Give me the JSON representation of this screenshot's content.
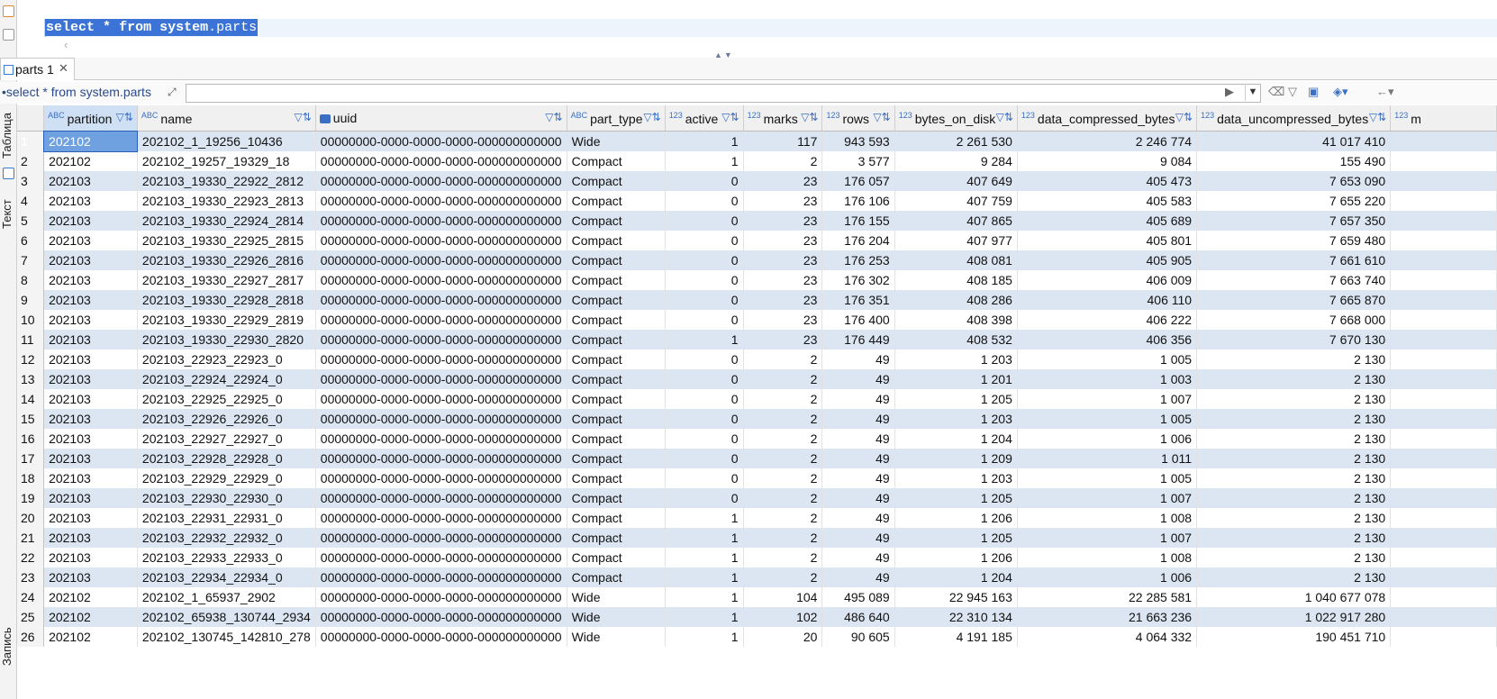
{
  "editor": {
    "sql_parts": [
      "select",
      "*",
      "from",
      "system",
      ".parts"
    ]
  },
  "result_tab": {
    "label": "parts 1"
  },
  "filter_bar": {
    "query_label": "select * from system.parts"
  },
  "side_tabs": [
    "Таблица",
    "Текст",
    "Запись"
  ],
  "grid": {
    "columns": [
      {
        "key": "partition",
        "type": "ABC"
      },
      {
        "key": "name",
        "type": "ABC"
      },
      {
        "key": "uuid",
        "type": "uuid"
      },
      {
        "key": "part_type",
        "type": "ABC"
      },
      {
        "key": "active",
        "type": "123"
      },
      {
        "key": "marks",
        "type": "123"
      },
      {
        "key": "rows",
        "type": "123"
      },
      {
        "key": "bytes_on_disk",
        "type": "123"
      },
      {
        "key": "data_compressed_bytes",
        "type": "123"
      },
      {
        "key": "data_uncompressed_bytes",
        "type": "123"
      },
      {
        "key": "m",
        "type": "123"
      }
    ],
    "rows": [
      [
        "1",
        "202102",
        "202102_1_19256_10436",
        "00000000-0000-0000-0000-000000000000",
        "Wide",
        "1",
        "117",
        "943 593",
        "2 261 530",
        "2 246 774",
        "41 017 410"
      ],
      [
        "2",
        "202102",
        "202102_19257_19329_18",
        "00000000-0000-0000-0000-000000000000",
        "Compact",
        "1",
        "2",
        "3 577",
        "9 284",
        "9 084",
        "155 490"
      ],
      [
        "3",
        "202103",
        "202103_19330_22922_2812",
        "00000000-0000-0000-0000-000000000000",
        "Compact",
        "0",
        "23",
        "176 057",
        "407 649",
        "405 473",
        "7 653 090"
      ],
      [
        "4",
        "202103",
        "202103_19330_22923_2813",
        "00000000-0000-0000-0000-000000000000",
        "Compact",
        "0",
        "23",
        "176 106",
        "407 759",
        "405 583",
        "7 655 220"
      ],
      [
        "5",
        "202103",
        "202103_19330_22924_2814",
        "00000000-0000-0000-0000-000000000000",
        "Compact",
        "0",
        "23",
        "176 155",
        "407 865",
        "405 689",
        "7 657 350"
      ],
      [
        "6",
        "202103",
        "202103_19330_22925_2815",
        "00000000-0000-0000-0000-000000000000",
        "Compact",
        "0",
        "23",
        "176 204",
        "407 977",
        "405 801",
        "7 659 480"
      ],
      [
        "7",
        "202103",
        "202103_19330_22926_2816",
        "00000000-0000-0000-0000-000000000000",
        "Compact",
        "0",
        "23",
        "176 253",
        "408 081",
        "405 905",
        "7 661 610"
      ],
      [
        "8",
        "202103",
        "202103_19330_22927_2817",
        "00000000-0000-0000-0000-000000000000",
        "Compact",
        "0",
        "23",
        "176 302",
        "408 185",
        "406 009",
        "7 663 740"
      ],
      [
        "9",
        "202103",
        "202103_19330_22928_2818",
        "00000000-0000-0000-0000-000000000000",
        "Compact",
        "0",
        "23",
        "176 351",
        "408 286",
        "406 110",
        "7 665 870"
      ],
      [
        "10",
        "202103",
        "202103_19330_22929_2819",
        "00000000-0000-0000-0000-000000000000",
        "Compact",
        "0",
        "23",
        "176 400",
        "408 398",
        "406 222",
        "7 668 000"
      ],
      [
        "11",
        "202103",
        "202103_19330_22930_2820",
        "00000000-0000-0000-0000-000000000000",
        "Compact",
        "1",
        "23",
        "176 449",
        "408 532",
        "406 356",
        "7 670 130"
      ],
      [
        "12",
        "202103",
        "202103_22923_22923_0",
        "00000000-0000-0000-0000-000000000000",
        "Compact",
        "0",
        "2",
        "49",
        "1 203",
        "1 005",
        "2 130"
      ],
      [
        "13",
        "202103",
        "202103_22924_22924_0",
        "00000000-0000-0000-0000-000000000000",
        "Compact",
        "0",
        "2",
        "49",
        "1 201",
        "1 003",
        "2 130"
      ],
      [
        "14",
        "202103",
        "202103_22925_22925_0",
        "00000000-0000-0000-0000-000000000000",
        "Compact",
        "0",
        "2",
        "49",
        "1 205",
        "1 007",
        "2 130"
      ],
      [
        "15",
        "202103",
        "202103_22926_22926_0",
        "00000000-0000-0000-0000-000000000000",
        "Compact",
        "0",
        "2",
        "49",
        "1 203",
        "1 005",
        "2 130"
      ],
      [
        "16",
        "202103",
        "202103_22927_22927_0",
        "00000000-0000-0000-0000-000000000000",
        "Compact",
        "0",
        "2",
        "49",
        "1 204",
        "1 006",
        "2 130"
      ],
      [
        "17",
        "202103",
        "202103_22928_22928_0",
        "00000000-0000-0000-0000-000000000000",
        "Compact",
        "0",
        "2",
        "49",
        "1 209",
        "1 011",
        "2 130"
      ],
      [
        "18",
        "202103",
        "202103_22929_22929_0",
        "00000000-0000-0000-0000-000000000000",
        "Compact",
        "0",
        "2",
        "49",
        "1 203",
        "1 005",
        "2 130"
      ],
      [
        "19",
        "202103",
        "202103_22930_22930_0",
        "00000000-0000-0000-0000-000000000000",
        "Compact",
        "0",
        "2",
        "49",
        "1 205",
        "1 007",
        "2 130"
      ],
      [
        "20",
        "202103",
        "202103_22931_22931_0",
        "00000000-0000-0000-0000-000000000000",
        "Compact",
        "1",
        "2",
        "49",
        "1 206",
        "1 008",
        "2 130"
      ],
      [
        "21",
        "202103",
        "202103_22932_22932_0",
        "00000000-0000-0000-0000-000000000000",
        "Compact",
        "1",
        "2",
        "49",
        "1 205",
        "1 007",
        "2 130"
      ],
      [
        "22",
        "202103",
        "202103_22933_22933_0",
        "00000000-0000-0000-0000-000000000000",
        "Compact",
        "1",
        "2",
        "49",
        "1 206",
        "1 008",
        "2 130"
      ],
      [
        "23",
        "202103",
        "202103_22934_22934_0",
        "00000000-0000-0000-0000-000000000000",
        "Compact",
        "1",
        "2",
        "49",
        "1 204",
        "1 006",
        "2 130"
      ],
      [
        "24",
        "202102",
        "202102_1_65937_2902",
        "00000000-0000-0000-0000-000000000000",
        "Wide",
        "1",
        "104",
        "495 089",
        "22 945 163",
        "22 285 581",
        "1 040 677 078"
      ],
      [
        "25",
        "202102",
        "202102_65938_130744_2934",
        "00000000-0000-0000-0000-000000000000",
        "Wide",
        "1",
        "102",
        "486 640",
        "22 310 134",
        "21 663 236",
        "1 022 917 280"
      ],
      [
        "26",
        "202102",
        "202102_130745_142810_278",
        "00000000-0000-0000-0000-000000000000",
        "Wide",
        "1",
        "20",
        "90 605",
        "4 191 185",
        "4 064 332",
        "190 451 710"
      ]
    ]
  }
}
